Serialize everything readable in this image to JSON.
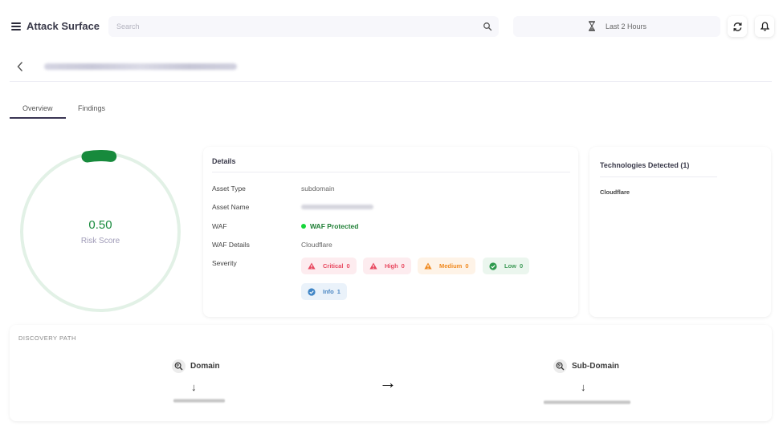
{
  "header": {
    "app_title": "Attack Surface",
    "search_placeholder": "Search",
    "time_range": "Last 2 Hours",
    "icons": {
      "menu": "hamburger-menu-icon",
      "search": "search-icon",
      "time": "hourglass-icon",
      "refresh": "refresh-icon",
      "notifications": "bell-icon"
    }
  },
  "asset_header": {
    "back_icon": "chevron-left-icon",
    "asset_title": "[blurred]"
  },
  "tabs": [
    {
      "label": "Overview",
      "active": true
    },
    {
      "label": "Findings",
      "active": false
    }
  ],
  "risk_gauge": {
    "value": "0.50",
    "label": "Risk Score",
    "fraction": 0.05,
    "colors": {
      "fill": "#178a3c",
      "track": "#e2f1e6"
    }
  },
  "details": {
    "title": "Details",
    "rows": [
      {
        "label": "Asset Type",
        "value": "subdomain"
      },
      {
        "label": "Asset Name",
        "value": "[blurred]"
      },
      {
        "label": "WAF",
        "value": "WAF Protected"
      },
      {
        "label": "WAF Details",
        "value": "Cloudflare"
      },
      {
        "label": "Severity",
        "value": ""
      }
    ],
    "severity": [
      {
        "label": "Critical",
        "count": "0",
        "icon": "warning-triangle-icon",
        "color": "#e8485f"
      },
      {
        "label": "High",
        "count": "0",
        "icon": "warning-triangle-icon",
        "color": "#e8485f"
      },
      {
        "label": "Medium",
        "count": "0",
        "icon": "warning-triangle-icon",
        "color": "#f08a20"
      },
      {
        "label": "Low",
        "count": "0",
        "icon": "check-circle-icon",
        "color": "#3e9a57"
      },
      {
        "label": "Info",
        "count": "1",
        "icon": "check-circle-icon",
        "color": "#4a86c2"
      }
    ]
  },
  "technologies": {
    "title": "Technologies Detected (1)",
    "items": [
      "Cloudflare"
    ]
  },
  "discovery_path": {
    "title": "DISCOVERY PATH",
    "nodes": [
      {
        "label": "Domain",
        "icon": "zoom-search-icon",
        "value": "[blurred]"
      },
      {
        "label": "Sub-Domain",
        "icon": "zoom-search-icon",
        "value": "[blurred]"
      }
    ],
    "connector": "→",
    "down_arrow": "↓"
  }
}
